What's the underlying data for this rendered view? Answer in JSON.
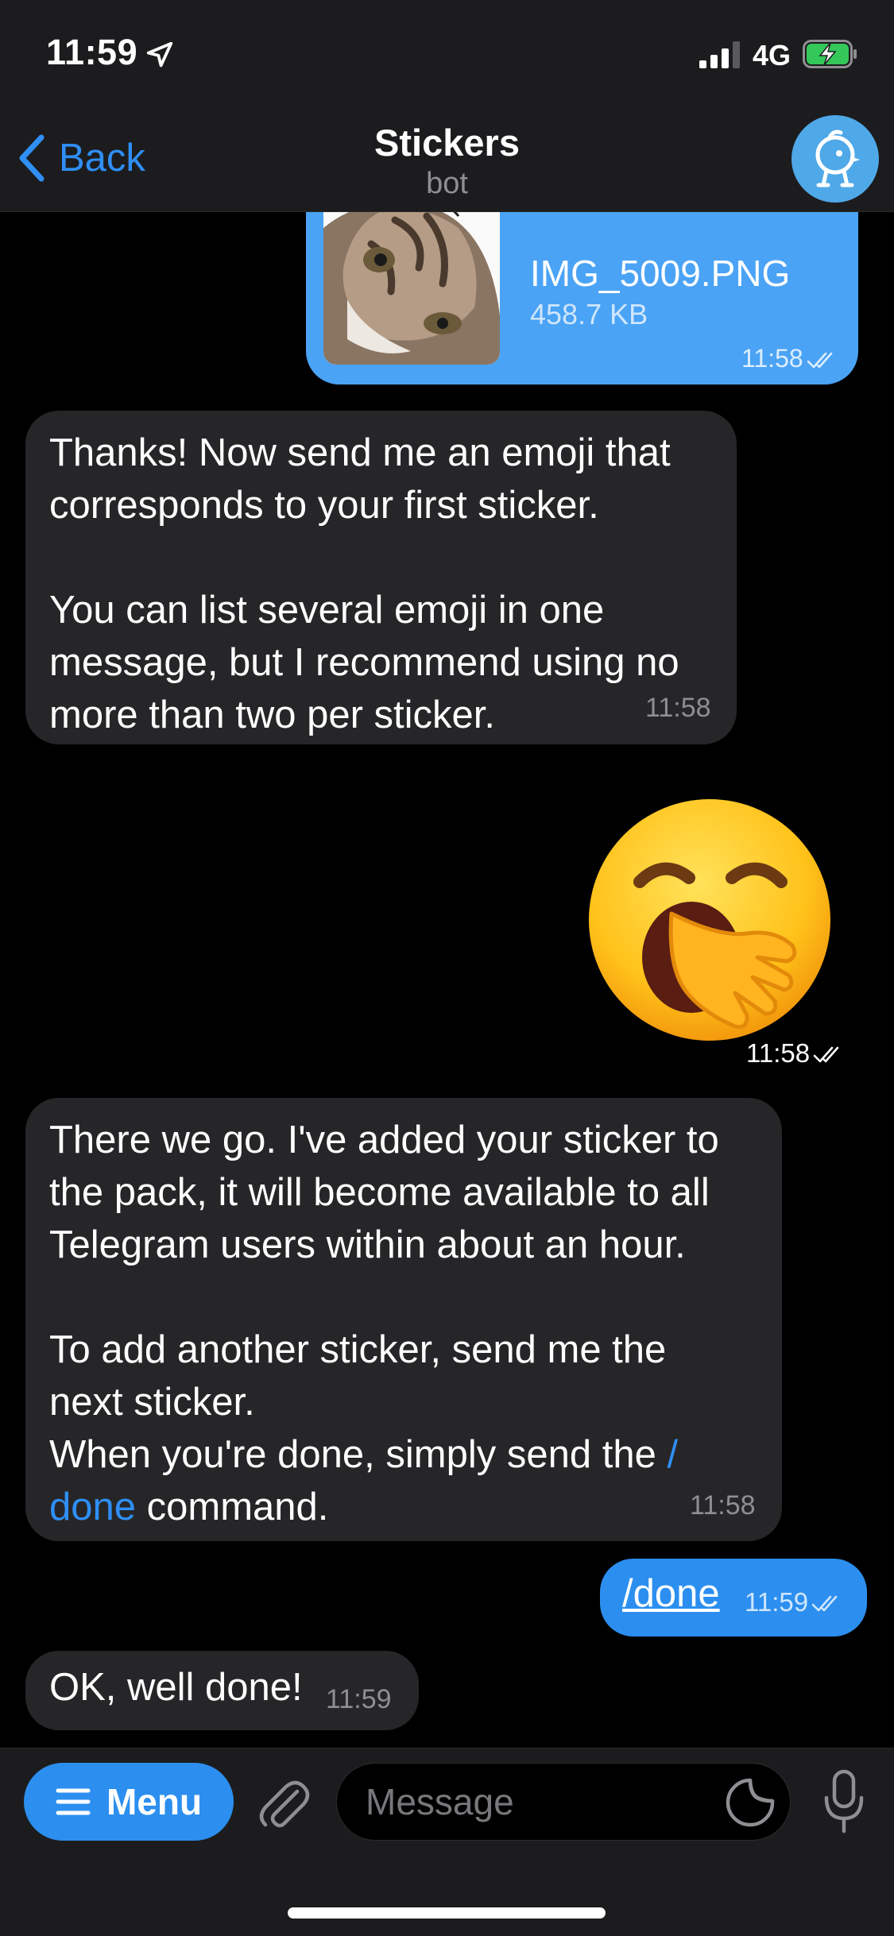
{
  "status_bar": {
    "time": "11:59",
    "network": "4G"
  },
  "nav": {
    "back_label": "Back",
    "title": "Stickers",
    "subtitle": "bot"
  },
  "messages": {
    "file": {
      "name": "IMG_5009.PNG",
      "size": "458.7 KB",
      "time": "11:58",
      "status": "read"
    },
    "bot1": {
      "text": "Thanks! Now send me an emoji that\ncorresponds to your first sticker.\n\nYou can list several emoji in one\nmessage, but I recommend using no\nmore than two per sticker.",
      "time": "11:58"
    },
    "emoji": {
      "icon": "yawning-face-emoji",
      "time": "11:58",
      "status": "read"
    },
    "bot2": {
      "text": "There we go. I've added your sticker to\nthe pack, it will become available to all\nTelegram users within about an hour.\n\nTo add another sticker, send me the\nnext sticker.\nWhen you're done, simply send the ",
      "link_a": "/",
      "link_b": "done",
      "text_end": " command.",
      "time": "11:58"
    },
    "done": {
      "text": "/done",
      "time": "11:59",
      "status": "read"
    },
    "bot3": {
      "text": "OK, well done!",
      "time": "11:59"
    }
  },
  "input_bar": {
    "menu_label": "Menu",
    "placeholder": "Message"
  },
  "colors": {
    "accent": "#2c8fef",
    "incoming_bubble": "#262628",
    "outgoing_file_bubble": "#4aa3f5",
    "background": "#000000",
    "bar_background": "#1c1c1e"
  }
}
